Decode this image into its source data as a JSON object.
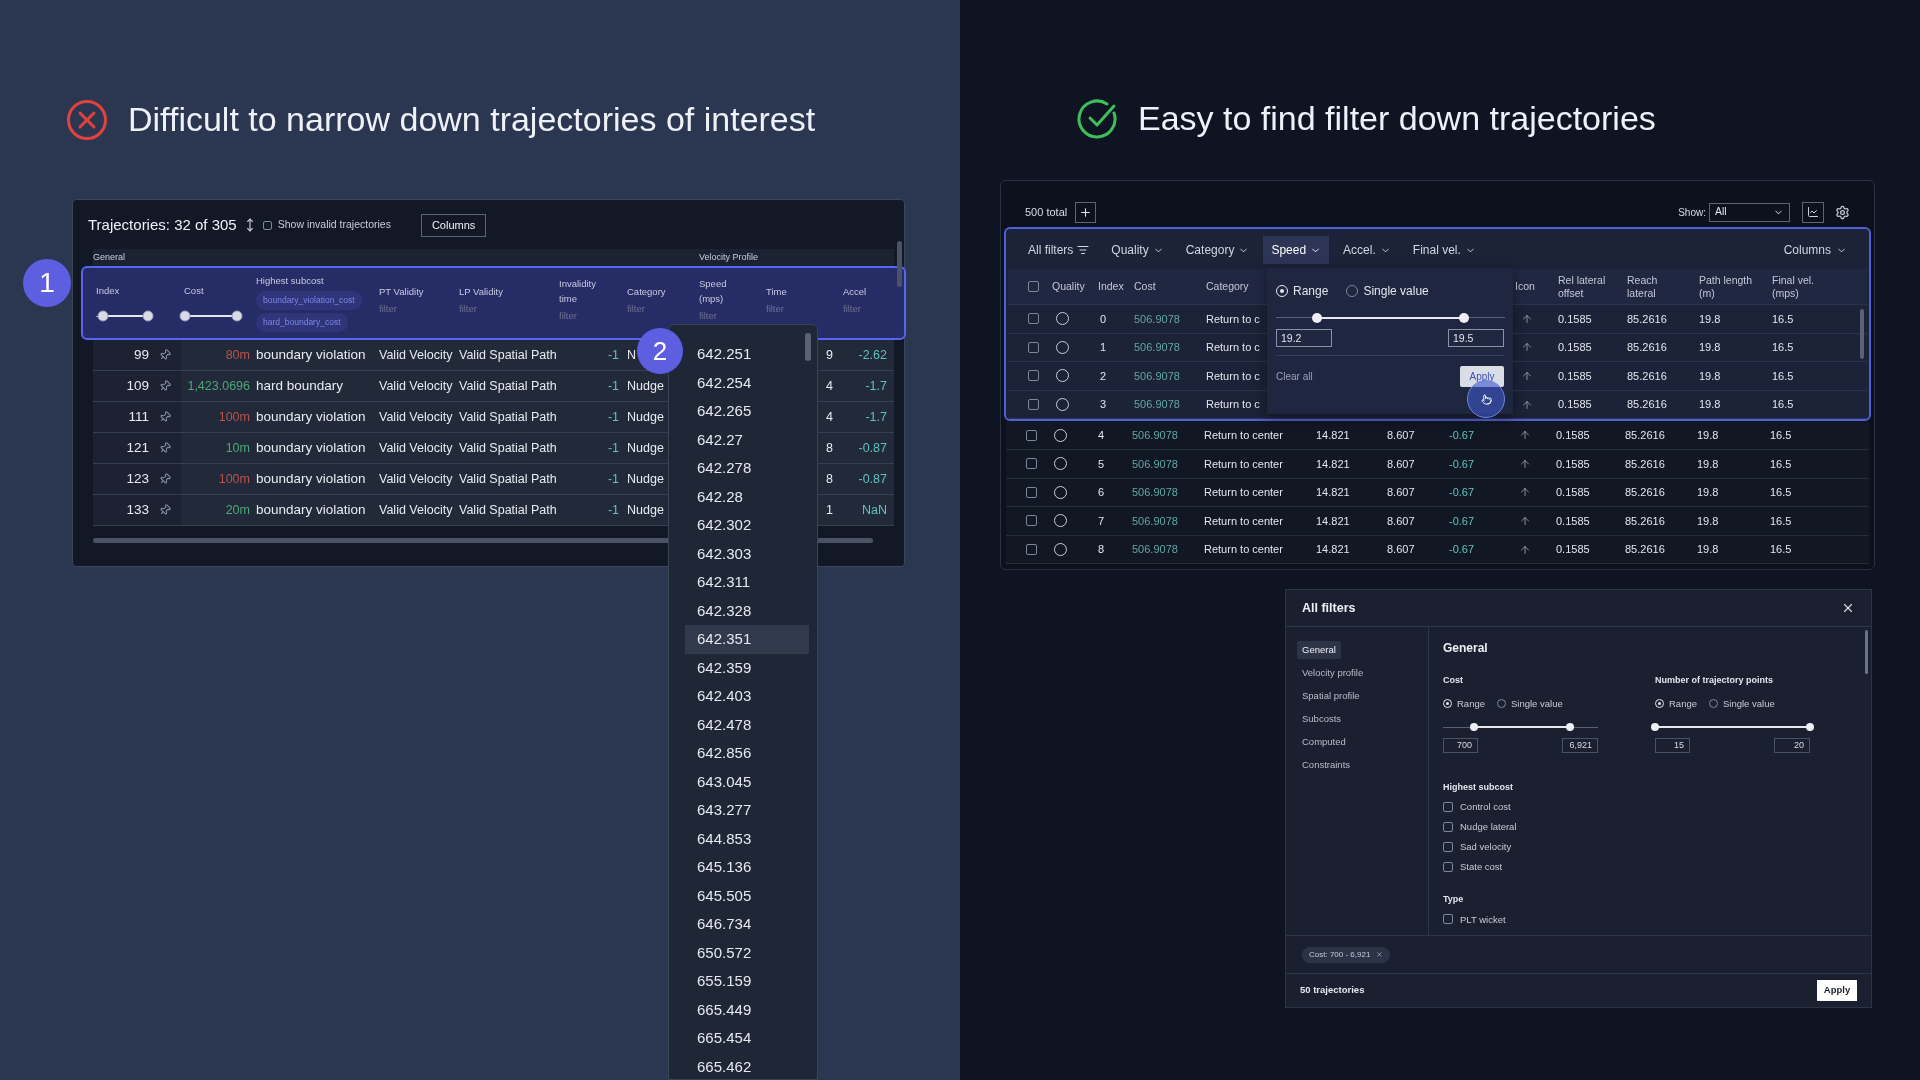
{
  "left": {
    "heading": "Difficult to narrow down trajectories of interest",
    "markers": [
      {
        "label": "1"
      },
      {
        "label": "2"
      }
    ],
    "table": {
      "title": "Trajectories: 32 of 305",
      "show_invalid": {
        "label": "Show invalid trajectories",
        "checked": false
      },
      "columns_button": "Columns",
      "groups": [
        "General",
        "Velocity Profile"
      ],
      "columns": [
        {
          "kind": "range",
          "label": "Index",
          "thumbs": [
            {
              "level": 0.12
            },
            {
              "level": 0.92
            }
          ]
        },
        {
          "kind": "range",
          "label": "Cost",
          "thumbs": [
            {
              "level": 0.02
            },
            {
              "level": 0.94
            }
          ]
        },
        {
          "kind": "chips",
          "label": "Highest subcost",
          "chips": [
            "boundary_violation_cost",
            "hard_boundary_cost"
          ]
        },
        {
          "kind": "filter",
          "label": "PT Validity",
          "placeholder": "filter"
        },
        {
          "kind": "filter",
          "label": "LP Validity",
          "placeholder": "filter"
        },
        {
          "kind": "filter",
          "label": "Invalidity time",
          "placeholder": "filter"
        },
        {
          "kind": "filter",
          "label": "Category",
          "placeholder": "filter"
        },
        {
          "kind": "filter",
          "label": "Speed (mps)",
          "placeholder": "filter"
        },
        {
          "kind": "filter",
          "label": "Time",
          "placeholder": "filter"
        },
        {
          "kind": "filter",
          "label": "Accel",
          "placeholder": "filter"
        }
      ],
      "rows": [
        {
          "index": "99",
          "cost": "80m",
          "color": "#b8524f",
          "subcost": "boundary violation",
          "pt_validity": "Valid Velocity",
          "lp_validity": "Valid Spatial Path",
          "invalidity_time": "-1",
          "category": "N",
          "time": "9",
          "accel": "-2.62"
        },
        {
          "index": "109",
          "cost": "1,423.0696",
          "color": "#4fa57a",
          "subcost": "hard boundary",
          "pt_validity": "Valid Velocity",
          "lp_validity": "Valid Spatial Path",
          "invalidity_time": "-1",
          "category": "Nudge",
          "time": "4",
          "accel": "-1.7"
        },
        {
          "index": "111",
          "cost": "100m",
          "color": "#b8524f",
          "subcost": "boundary violation",
          "pt_validity": "Valid Velocity",
          "lp_validity": "Valid Spatial Path",
          "invalidity_time": "-1",
          "category": "Nudge",
          "time": "4",
          "accel": "-1.7"
        },
        {
          "index": "121",
          "cost": "10m",
          "color": "#4fa57a",
          "subcost": "boundary violation",
          "pt_validity": "Valid Velocity",
          "lp_validity": "Valid Spatial Path",
          "invalidity_time": "-1",
          "category": "Nudge",
          "time": "8",
          "accel": "-0.87"
        },
        {
          "index": "123",
          "cost": "100m",
          "color": "#b8524f",
          "subcost": "boundary violation",
          "pt_validity": "Valid Velocity",
          "lp_validity": "Valid Spatial Path",
          "invalidity_time": "-1",
          "category": "Nudge",
          "time": "8",
          "accel": "-0.87"
        },
        {
          "index": "133",
          "cost": "20m",
          "color": "#4fa57a",
          "subcost": "boundary violation",
          "pt_validity": "Valid Velocity",
          "lp_validity": "Valid Spatial Path",
          "invalidity_time": "-1",
          "category": "Nudge",
          "time": "1",
          "accel": "NaN"
        }
      ]
    },
    "dropdown": {
      "items": [
        {
          "label": "642.251",
          "selected": false
        },
        {
          "label": "642.254",
          "selected": false
        },
        {
          "label": "642.265",
          "selected": false
        },
        {
          "label": "642.27",
          "selected": false
        },
        {
          "label": "642.278",
          "selected": false
        },
        {
          "label": "642.28",
          "selected": false
        },
        {
          "label": "642.302",
          "selected": false
        },
        {
          "label": "642.303",
          "selected": false
        },
        {
          "label": "642.311",
          "selected": false
        },
        {
          "label": "642.328",
          "selected": false
        },
        {
          "label": "642.351",
          "selected": true
        },
        {
          "label": "642.359",
          "selected": false
        },
        {
          "label": "642.403",
          "selected": false
        },
        {
          "label": "642.478",
          "selected": false
        },
        {
          "label": "642.856",
          "selected": false
        },
        {
          "label": "643.045",
          "selected": false
        },
        {
          "label": "643.277",
          "selected": false
        },
        {
          "label": "644.853",
          "selected": false
        },
        {
          "label": "645.136",
          "selected": false
        },
        {
          "label": "645.505",
          "selected": false
        },
        {
          "label": "646.734",
          "selected": false
        },
        {
          "label": "650.572",
          "selected": false
        },
        {
          "label": "655.159",
          "selected": false
        },
        {
          "label": "665.449",
          "selected": false
        },
        {
          "label": "665.454",
          "selected": false
        },
        {
          "label": "665.462",
          "selected": false
        }
      ]
    }
  },
  "right": {
    "heading": "Easy to find filter down trajectories",
    "table": {
      "total": "500 total",
      "show_label": "Show:",
      "show_value": "All",
      "filters": [
        {
          "kind": "all",
          "label": "All filters",
          "selected": false
        },
        {
          "kind": "menu",
          "label": "Quality",
          "selected": false
        },
        {
          "kind": "menu",
          "label": "Category",
          "selected": false
        },
        {
          "kind": "menu",
          "label": "Speed",
          "selected": true
        },
        {
          "kind": "menu",
          "label": "Accel.",
          "selected": false
        },
        {
          "kind": "menu",
          "label": "Final vel.",
          "selected": false
        }
      ],
      "columns_menu": "Columns",
      "header": {
        "select_all": {
          "checked": false
        },
        "quality": "Quality",
        "index": "Index",
        "cost": "Cost",
        "category": "Category",
        "icon": "Icon",
        "rel_lateral": "Rel lateral offset",
        "reach": "Reach lateral",
        "path": "Path length (m)",
        "final_vel": "Final vel. (mps)"
      },
      "rows": [
        {
          "checked": false,
          "index": "0",
          "cost": "506.9078",
          "category": "Return to c",
          "rel_lateral": "0.1585",
          "reach": "85.2616",
          "path": "19.8",
          "final_vel": "16.5"
        },
        {
          "checked": false,
          "index": "1",
          "cost": "506.9078",
          "category": "Return to c",
          "rel_lateral": "0.1585",
          "reach": "85.2616",
          "path": "19.8",
          "final_vel": "16.5"
        },
        {
          "checked": false,
          "index": "2",
          "cost": "506.9078",
          "category": "Return to c",
          "rel_lateral": "0.1585",
          "reach": "85.2616",
          "path": "19.8",
          "final_vel": "16.5"
        },
        {
          "checked": false,
          "index": "3",
          "cost": "506.9078",
          "category": "Return to c",
          "rel_lateral": "0.1585",
          "reach": "85.2616",
          "path": "19.8",
          "final_vel": "16.5"
        },
        {
          "checked": false,
          "index": "4",
          "cost": "506.9078",
          "category": "Return to center",
          "column_6": "14.821",
          "column_7": "8.607",
          "column_8": "-0.67",
          "rel_lateral": "0.1585",
          "reach": "85.2616",
          "path": "19.8",
          "final_vel": "16.5"
        },
        {
          "checked": false,
          "index": "5",
          "cost": "506.9078",
          "category": "Return to center",
          "column_6": "14.821",
          "column_7": "8.607",
          "column_8": "-0.67",
          "rel_lateral": "0.1585",
          "reach": "85.2616",
          "path": "19.8",
          "final_vel": "16.5"
        },
        {
          "checked": false,
          "index": "6",
          "cost": "506.9078",
          "category": "Return to center",
          "column_6": "14.821",
          "column_7": "8.607",
          "column_8": "-0.67",
          "rel_lateral": "0.1585",
          "reach": "85.2616",
          "path": "19.8",
          "final_vel": "16.5"
        },
        {
          "checked": false,
          "index": "7",
          "cost": "506.9078",
          "category": "Return to center",
          "column_6": "14.821",
          "column_7": "8.607",
          "column_8": "-0.67",
          "rel_lateral": "0.1585",
          "reach": "85.2616",
          "path": "19.8",
          "final_vel": "16.5"
        },
        {
          "checked": false,
          "index": "8",
          "cost": "506.9078",
          "category": "Return to center",
          "column_6": "14.821",
          "column_7": "8.607",
          "column_8": "-0.67",
          "rel_lateral": "0.1585",
          "reach": "85.2616",
          "path": "19.8",
          "final_vel": "16.5"
        }
      ],
      "speed_popover": {
        "options": [
          {
            "label": "Range",
            "selected": true
          },
          {
            "label": "Single value",
            "selected": false
          }
        ],
        "thumbs": [
          {
            "level": 0.18
          },
          {
            "level": 0.82
          }
        ],
        "min": "19.2",
        "max": "19.5",
        "clear": "Clear all",
        "apply": "Apply"
      }
    },
    "filter_dialog": {
      "title": "All filters",
      "nav": [
        {
          "label": "General",
          "selected": true
        },
        {
          "label": "Velocity profile",
          "selected": false
        },
        {
          "label": "Spatial profile",
          "selected": false
        },
        {
          "label": "Subcosts",
          "selected": false
        },
        {
          "label": "Computed",
          "selected": false
        },
        {
          "label": "Constraints",
          "selected": false
        }
      ],
      "section": "General",
      "ranges": [
        {
          "label": "Cost",
          "options": [
            {
              "label": "Range",
              "selected": true
            },
            {
              "label": "Single value",
              "selected": false
            }
          ],
          "thumbs": [
            {
              "level": 0.2
            },
            {
              "level": 0.82
            }
          ],
          "min": "700",
          "max": "6,921"
        },
        {
          "label": "Number of trajectory points",
          "options": [
            {
              "label": "Range",
              "selected": true
            },
            {
              "label": "Single value",
              "selected": false
            }
          ],
          "thumbs": [
            {
              "level": 0
            },
            {
              "level": 1
            }
          ],
          "min": "15",
          "max": "20"
        }
      ],
      "groups": [
        {
          "label": "Highest subcost",
          "options": [
            {
              "label": "Control cost",
              "checked": false
            },
            {
              "label": "Nudge lateral",
              "checked": false
            },
            {
              "label": "Sad velocity",
              "checked": false
            },
            {
              "label": "State cost",
              "checked": false
            }
          ]
        },
        {
          "label": "Type",
          "options": [
            {
              "label": "PLT wicket",
              "checked": false
            }
          ]
        }
      ],
      "chips": [
        "Cost: 700 - 6,921"
      ],
      "count": "50 trajectories",
      "apply": "Apply"
    }
  }
}
